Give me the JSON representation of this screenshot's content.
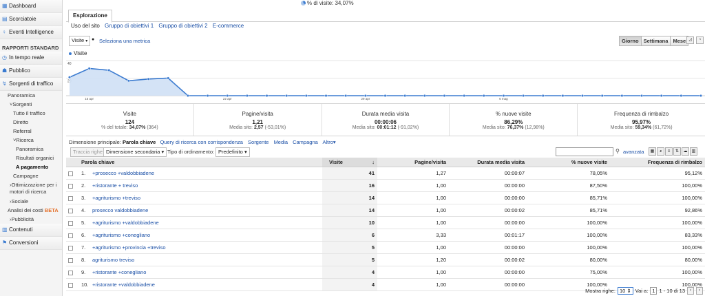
{
  "sidebar": {
    "top_items": [
      {
        "label": "Dashboard",
        "icon": "dashboard-icon"
      },
      {
        "label": "Scorciatoie",
        "icon": "shortcut-icon"
      },
      {
        "label": "Eventi Intelligence",
        "icon": "lightbulb-icon"
      }
    ],
    "section_title": "RAPPORTI STANDARD",
    "realtime": "In tempo reale",
    "audience": "Pubblico",
    "traffic": "Sorgenti di traffico",
    "panoramica": "Panoramica",
    "sorgenti": "Sorgenti",
    "tutto": "Tutto il traffico",
    "diretto": "Diretto",
    "referral": "Referral",
    "ricerca": "Ricerca",
    "ric_panoramica": "Panoramica",
    "organici": "Risultati organici",
    "pagamento": "A pagamento",
    "campagne": "Campagne",
    "ottimizzazione": "Ottimizzazione per i motori di ricerca",
    "sociale": "Sociale",
    "analisi": "Analisi dei costi",
    "beta": "BETA",
    "pubblicita": "Pubblicità",
    "contenuti": "Contenuti",
    "conversioni": "Conversioni"
  },
  "top_legend": "% di visite: 34,07%",
  "tab": "Esplorazione",
  "subtabs": [
    "Uso del sito",
    "Gruppo di obiettivi 1",
    "Gruppo di obiettivi 2",
    "E-commerce"
  ],
  "metric_select": "Visite",
  "vs": "●",
  "add_metric": "Seleziona una metrica",
  "periods": [
    "Giorno",
    "Settimana",
    "Mese"
  ],
  "active_period": "Giorno",
  "chart_data": {
    "type": "area",
    "series": [
      {
        "name": "Visite",
        "values": [
          21,
          31,
          29,
          17,
          19,
          20,
          0,
          0,
          0,
          0,
          0,
          0,
          0,
          0,
          0,
          0,
          0,
          0,
          0,
          0,
          0,
          0,
          0,
          0,
          0,
          0,
          0,
          0,
          0,
          0,
          0,
          0,
          0
        ]
      }
    ],
    "y_ticks": [
      "40",
      "20"
    ],
    "ylim": [
      0,
      40
    ],
    "x_ticks": [
      {
        "label": "15 apr",
        "index": 1
      },
      {
        "label": "22 apr",
        "index": 8
      },
      {
        "label": "29 apr",
        "index": 15
      },
      {
        "label": "6 mag",
        "index": 22
      }
    ],
    "color": "#3b7bd0"
  },
  "summary": [
    {
      "title": "Visite",
      "value": "124",
      "sub_label": "% del totale:",
      "sub_value": "34,07%",
      "sub_extra": "(364)"
    },
    {
      "title": "Pagine/visita",
      "value": "1,21",
      "sub_label": "Media sito:",
      "sub_value": "2,57",
      "sub_extra": "(-53,01%)"
    },
    {
      "title": "Durata media visita",
      "value": "00:00:06",
      "sub_label": "Media sito:",
      "sub_value": "00:01:12",
      "sub_extra": "(-91,02%)"
    },
    {
      "title": "% nuove visite",
      "value": "86,29%",
      "sub_label": "Media sito:",
      "sub_value": "76,37%",
      "sub_extra": "(12,98%)"
    },
    {
      "title": "Frequenza di rimbalzo",
      "value": "95,97%",
      "sub_label": "Media sito:",
      "sub_value": "59,34%",
      "sub_extra": "(61,72%)"
    }
  ],
  "dimbar": {
    "label": "Dimensione principale:",
    "current": "Parola chiave",
    "links": [
      "Query di ricerca con corrispondenza",
      "Sorgente",
      "Media",
      "Campagna",
      "Altro"
    ]
  },
  "tools": {
    "plot_rows": "Traccia righe",
    "secondary": "Dimensione secondaria",
    "sort_label": "Tipo di ordinamento:",
    "sort_value": "Predefinito",
    "advanced": "avanzata"
  },
  "table": {
    "headers": {
      "kw": "Parola chiave",
      "visits": "Visite",
      "sort_arrow": "↓",
      "ppv": "Pagine/visita",
      "dur": "Durata media visita",
      "new": "% nuove visite",
      "bounce": "Frequenza di rimbalzo"
    },
    "rows": [
      {
        "n": "1.",
        "kw": "+prosecco +valdobbiadene",
        "visits": "41",
        "ppv": "1,27",
        "dur": "00:00:07",
        "new": "78,05%",
        "bounce": "95,12%"
      },
      {
        "n": "2.",
        "kw": "+ristorante + treviso",
        "visits": "16",
        "ppv": "1,00",
        "dur": "00:00:00",
        "new": "87,50%",
        "bounce": "100,00%"
      },
      {
        "n": "3.",
        "kw": "+agriturismo +treviso",
        "visits": "14",
        "ppv": "1,00",
        "dur": "00:00:00",
        "new": "85,71%",
        "bounce": "100,00%"
      },
      {
        "n": "4.",
        "kw": "prosecco valdobbiadene",
        "visits": "14",
        "ppv": "1,00",
        "dur": "00:00:02",
        "new": "85,71%",
        "bounce": "92,86%"
      },
      {
        "n": "5.",
        "kw": "+agriturismo +valdobbiadene",
        "visits": "10",
        "ppv": "1,00",
        "dur": "00:00:00",
        "new": "100,00%",
        "bounce": "100,00%"
      },
      {
        "n": "6.",
        "kw": "+agriturismo +conegliano",
        "visits": "6",
        "ppv": "3,33",
        "dur": "00:01:17",
        "new": "100,00%",
        "bounce": "83,33%"
      },
      {
        "n": "7.",
        "kw": "+agriturismo +provincia +treviso",
        "visits": "5",
        "ppv": "1,00",
        "dur": "00:00:00",
        "new": "100,00%",
        "bounce": "100,00%"
      },
      {
        "n": "8.",
        "kw": "agriturismo treviso",
        "visits": "5",
        "ppv": "1,20",
        "dur": "00:00:02",
        "new": "80,00%",
        "bounce": "80,00%"
      },
      {
        "n": "9.",
        "kw": "+ristorante +conegliano",
        "visits": "4",
        "ppv": "1,00",
        "dur": "00:00:00",
        "new": "75,00%",
        "bounce": "100,00%"
      },
      {
        "n": "10.",
        "kw": "+ristorante +valdobbiadene",
        "visits": "4",
        "ppv": "1,00",
        "dur": "00:00:00",
        "new": "100,00%",
        "bounce": "100,00%"
      }
    ]
  },
  "pager": {
    "show_label": "Mostra righe:",
    "show_value": "10",
    "goto_label": "Vai a:",
    "goto_value": "1",
    "range": "1 - 10 di 13"
  }
}
